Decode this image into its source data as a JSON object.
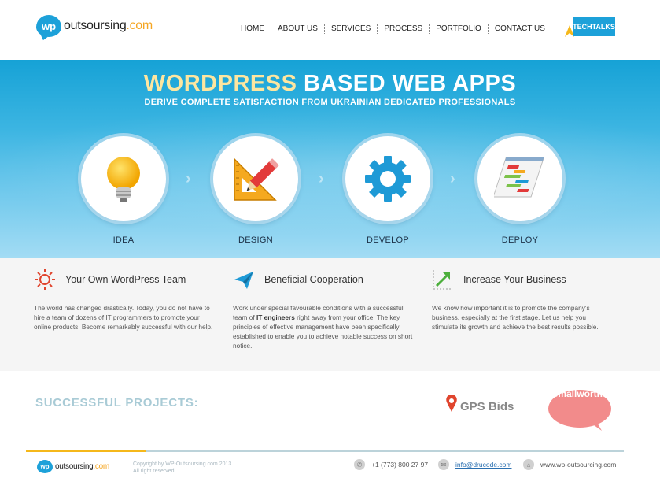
{
  "header": {
    "logo_badge": "wp",
    "logo_main": "outsoursing",
    "logo_dotcom": ".com",
    "nav": [
      "HOME",
      "ABOUT US",
      "SERVICES",
      "PROCESS",
      "PORTFOLIO",
      "CONTACT US"
    ],
    "techtalks": "TECHTALKS"
  },
  "hero": {
    "title_highlight": "WORDPRESS",
    "title_rest": " BASED WEB APPS",
    "subtitle": "DERIVE COMPLETE SATISFACTION FROM UKRAINIAN DEDICATED PROFESSIONALS",
    "steps": [
      {
        "label": "IDEA",
        "icon": "lightbulb-icon"
      },
      {
        "label": "DESIGN",
        "icon": "pencil-ruler-icon"
      },
      {
        "label": "DEVELOP",
        "icon": "gear-icon"
      },
      {
        "label": "DEPLOY",
        "icon": "gantt-chart-icon"
      }
    ]
  },
  "features": [
    {
      "title": "Your Own WordPress Team",
      "icon": "sun-icon",
      "text": "The world has changed drastically. Today, you do not have to hire a team of dozens of IT programmers to promote your online products. Become remarkably successful with our help."
    },
    {
      "title": "Beneficial Cooperation",
      "icon": "paper-plane-icon",
      "text_before": "Work under special favourable conditions with a successful team of ",
      "text_bold": "IT engineers",
      "text_after": " right away from your office. The key principles of effective management have been specifically established to enable you to achieve notable success on short notice."
    },
    {
      "title": "Increase Your Business",
      "icon": "growth-arrow-icon",
      "text": "We know how important it is to promote the company's business, especially at the first stage. Let us help you stimulate its growth and achieve the best results possible."
    }
  ],
  "projects": {
    "title": "SUCCESSFUL PROJECTS:",
    "logos": [
      "GPS Bids",
      "Smallworths"
    ]
  },
  "footer": {
    "logo_badge": "wp",
    "logo_main": "outsoursing",
    "logo_dotcom": ".com",
    "copyright_line1": "Copyright by WP-Outsoursing.com 2013.",
    "copyright_line2": "All right reserved.",
    "phone": "+1 (773) 800 27 97",
    "email": "info@drucode.com",
    "website": "www.wp-outsourcing.com"
  },
  "colors": {
    "brand_blue": "#1da1d9",
    "accent_yellow": "#f5b81b",
    "title_highlight": "#fde6a0"
  }
}
